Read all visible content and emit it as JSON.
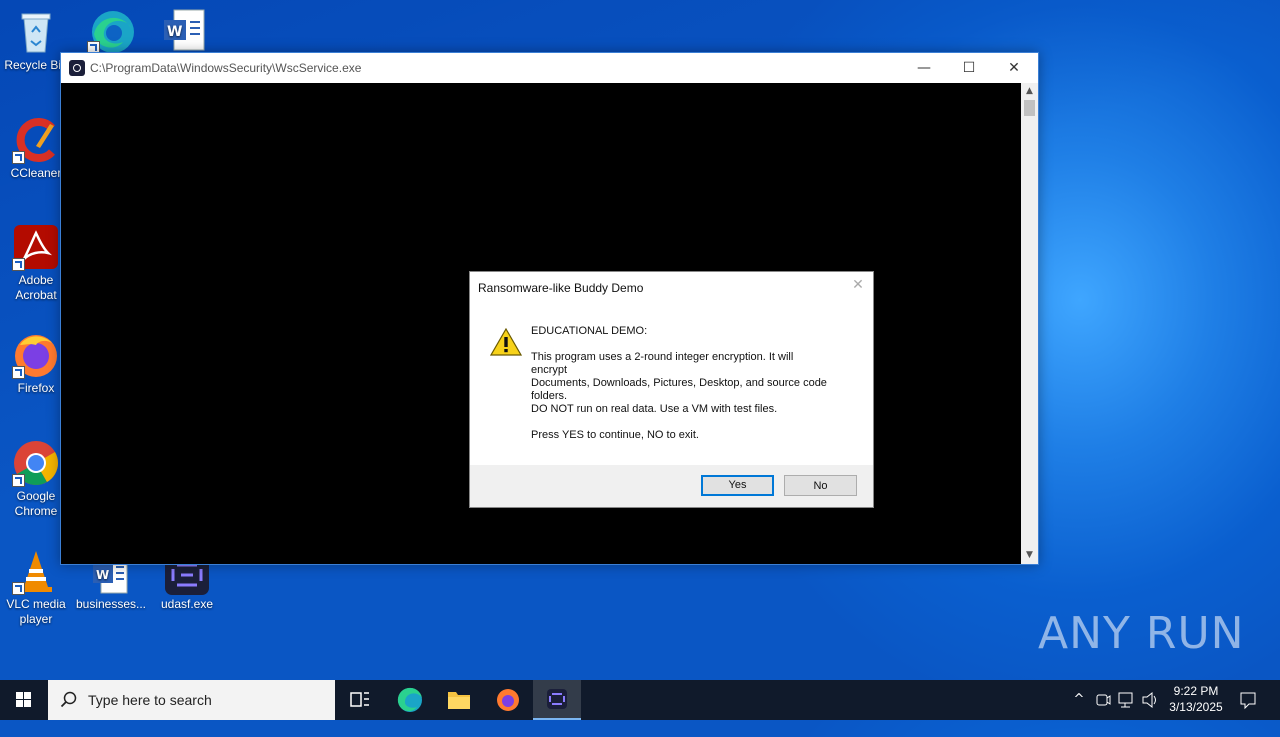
{
  "desktop": {
    "icons": [
      {
        "label": "Recycle Bin"
      },
      {
        "label": "CCleaner"
      },
      {
        "label": "Adobe Acrobat"
      },
      {
        "label": "Firefox"
      },
      {
        "label": "Google Chrome"
      },
      {
        "label": "VLC media player"
      },
      {
        "label": "businesses..."
      },
      {
        "label": "udasf.exe"
      }
    ]
  },
  "console_window": {
    "title": "C:\\ProgramData\\WindowsSecurity\\WscService.exe",
    "controls": {
      "minimize": "—",
      "maximize": "☐",
      "close": "✕"
    }
  },
  "dialog": {
    "title": "Ransomware-like Buddy Demo",
    "heading": "EDUCATIONAL DEMO:",
    "body": "This program uses a 2-round integer encryption. It will\nencrypt\nDocuments, Downloads, Pictures, Desktop, and source code\nfolders.\nDO NOT run on real data. Use a VM with test files.",
    "prompt": "Press YES to continue, NO to exit.",
    "yes_label": "Yes",
    "no_label": "No"
  },
  "watermark": "ANY RUN",
  "taskbar": {
    "search_placeholder": "Type here to search",
    "time": "9:22 PM",
    "date": "3/13/2025"
  },
  "colors": {
    "accent": "#0078d7",
    "taskbar": "#101a2b",
    "desktop": "#0a5fcf"
  }
}
